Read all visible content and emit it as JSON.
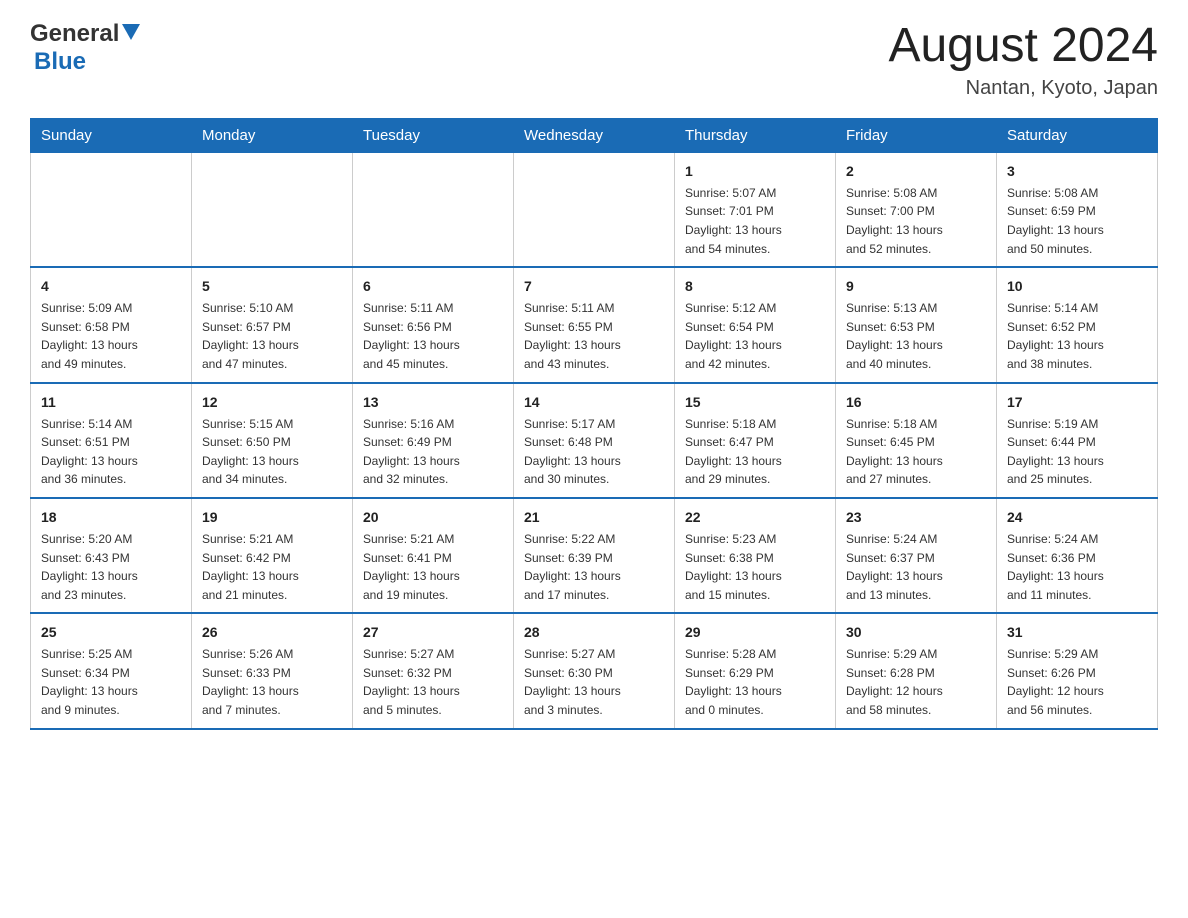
{
  "header": {
    "logo_general": "General",
    "logo_blue": "Blue",
    "month_year": "August 2024",
    "location": "Nantan, Kyoto, Japan"
  },
  "weekdays": [
    "Sunday",
    "Monday",
    "Tuesday",
    "Wednesday",
    "Thursday",
    "Friday",
    "Saturday"
  ],
  "weeks": [
    [
      {
        "day": "",
        "info": ""
      },
      {
        "day": "",
        "info": ""
      },
      {
        "day": "",
        "info": ""
      },
      {
        "day": "",
        "info": ""
      },
      {
        "day": "1",
        "info": "Sunrise: 5:07 AM\nSunset: 7:01 PM\nDaylight: 13 hours\nand 54 minutes."
      },
      {
        "day": "2",
        "info": "Sunrise: 5:08 AM\nSunset: 7:00 PM\nDaylight: 13 hours\nand 52 minutes."
      },
      {
        "day": "3",
        "info": "Sunrise: 5:08 AM\nSunset: 6:59 PM\nDaylight: 13 hours\nand 50 minutes."
      }
    ],
    [
      {
        "day": "4",
        "info": "Sunrise: 5:09 AM\nSunset: 6:58 PM\nDaylight: 13 hours\nand 49 minutes."
      },
      {
        "day": "5",
        "info": "Sunrise: 5:10 AM\nSunset: 6:57 PM\nDaylight: 13 hours\nand 47 minutes."
      },
      {
        "day": "6",
        "info": "Sunrise: 5:11 AM\nSunset: 6:56 PM\nDaylight: 13 hours\nand 45 minutes."
      },
      {
        "day": "7",
        "info": "Sunrise: 5:11 AM\nSunset: 6:55 PM\nDaylight: 13 hours\nand 43 minutes."
      },
      {
        "day": "8",
        "info": "Sunrise: 5:12 AM\nSunset: 6:54 PM\nDaylight: 13 hours\nand 42 minutes."
      },
      {
        "day": "9",
        "info": "Sunrise: 5:13 AM\nSunset: 6:53 PM\nDaylight: 13 hours\nand 40 minutes."
      },
      {
        "day": "10",
        "info": "Sunrise: 5:14 AM\nSunset: 6:52 PM\nDaylight: 13 hours\nand 38 minutes."
      }
    ],
    [
      {
        "day": "11",
        "info": "Sunrise: 5:14 AM\nSunset: 6:51 PM\nDaylight: 13 hours\nand 36 minutes."
      },
      {
        "day": "12",
        "info": "Sunrise: 5:15 AM\nSunset: 6:50 PM\nDaylight: 13 hours\nand 34 minutes."
      },
      {
        "day": "13",
        "info": "Sunrise: 5:16 AM\nSunset: 6:49 PM\nDaylight: 13 hours\nand 32 minutes."
      },
      {
        "day": "14",
        "info": "Sunrise: 5:17 AM\nSunset: 6:48 PM\nDaylight: 13 hours\nand 30 minutes."
      },
      {
        "day": "15",
        "info": "Sunrise: 5:18 AM\nSunset: 6:47 PM\nDaylight: 13 hours\nand 29 minutes."
      },
      {
        "day": "16",
        "info": "Sunrise: 5:18 AM\nSunset: 6:45 PM\nDaylight: 13 hours\nand 27 minutes."
      },
      {
        "day": "17",
        "info": "Sunrise: 5:19 AM\nSunset: 6:44 PM\nDaylight: 13 hours\nand 25 minutes."
      }
    ],
    [
      {
        "day": "18",
        "info": "Sunrise: 5:20 AM\nSunset: 6:43 PM\nDaylight: 13 hours\nand 23 minutes."
      },
      {
        "day": "19",
        "info": "Sunrise: 5:21 AM\nSunset: 6:42 PM\nDaylight: 13 hours\nand 21 minutes."
      },
      {
        "day": "20",
        "info": "Sunrise: 5:21 AM\nSunset: 6:41 PM\nDaylight: 13 hours\nand 19 minutes."
      },
      {
        "day": "21",
        "info": "Sunrise: 5:22 AM\nSunset: 6:39 PM\nDaylight: 13 hours\nand 17 minutes."
      },
      {
        "day": "22",
        "info": "Sunrise: 5:23 AM\nSunset: 6:38 PM\nDaylight: 13 hours\nand 15 minutes."
      },
      {
        "day": "23",
        "info": "Sunrise: 5:24 AM\nSunset: 6:37 PM\nDaylight: 13 hours\nand 13 minutes."
      },
      {
        "day": "24",
        "info": "Sunrise: 5:24 AM\nSunset: 6:36 PM\nDaylight: 13 hours\nand 11 minutes."
      }
    ],
    [
      {
        "day": "25",
        "info": "Sunrise: 5:25 AM\nSunset: 6:34 PM\nDaylight: 13 hours\nand 9 minutes."
      },
      {
        "day": "26",
        "info": "Sunrise: 5:26 AM\nSunset: 6:33 PM\nDaylight: 13 hours\nand 7 minutes."
      },
      {
        "day": "27",
        "info": "Sunrise: 5:27 AM\nSunset: 6:32 PM\nDaylight: 13 hours\nand 5 minutes."
      },
      {
        "day": "28",
        "info": "Sunrise: 5:27 AM\nSunset: 6:30 PM\nDaylight: 13 hours\nand 3 minutes."
      },
      {
        "day": "29",
        "info": "Sunrise: 5:28 AM\nSunset: 6:29 PM\nDaylight: 13 hours\nand 0 minutes."
      },
      {
        "day": "30",
        "info": "Sunrise: 5:29 AM\nSunset: 6:28 PM\nDaylight: 12 hours\nand 58 minutes."
      },
      {
        "day": "31",
        "info": "Sunrise: 5:29 AM\nSunset: 6:26 PM\nDaylight: 12 hours\nand 56 minutes."
      }
    ]
  ]
}
